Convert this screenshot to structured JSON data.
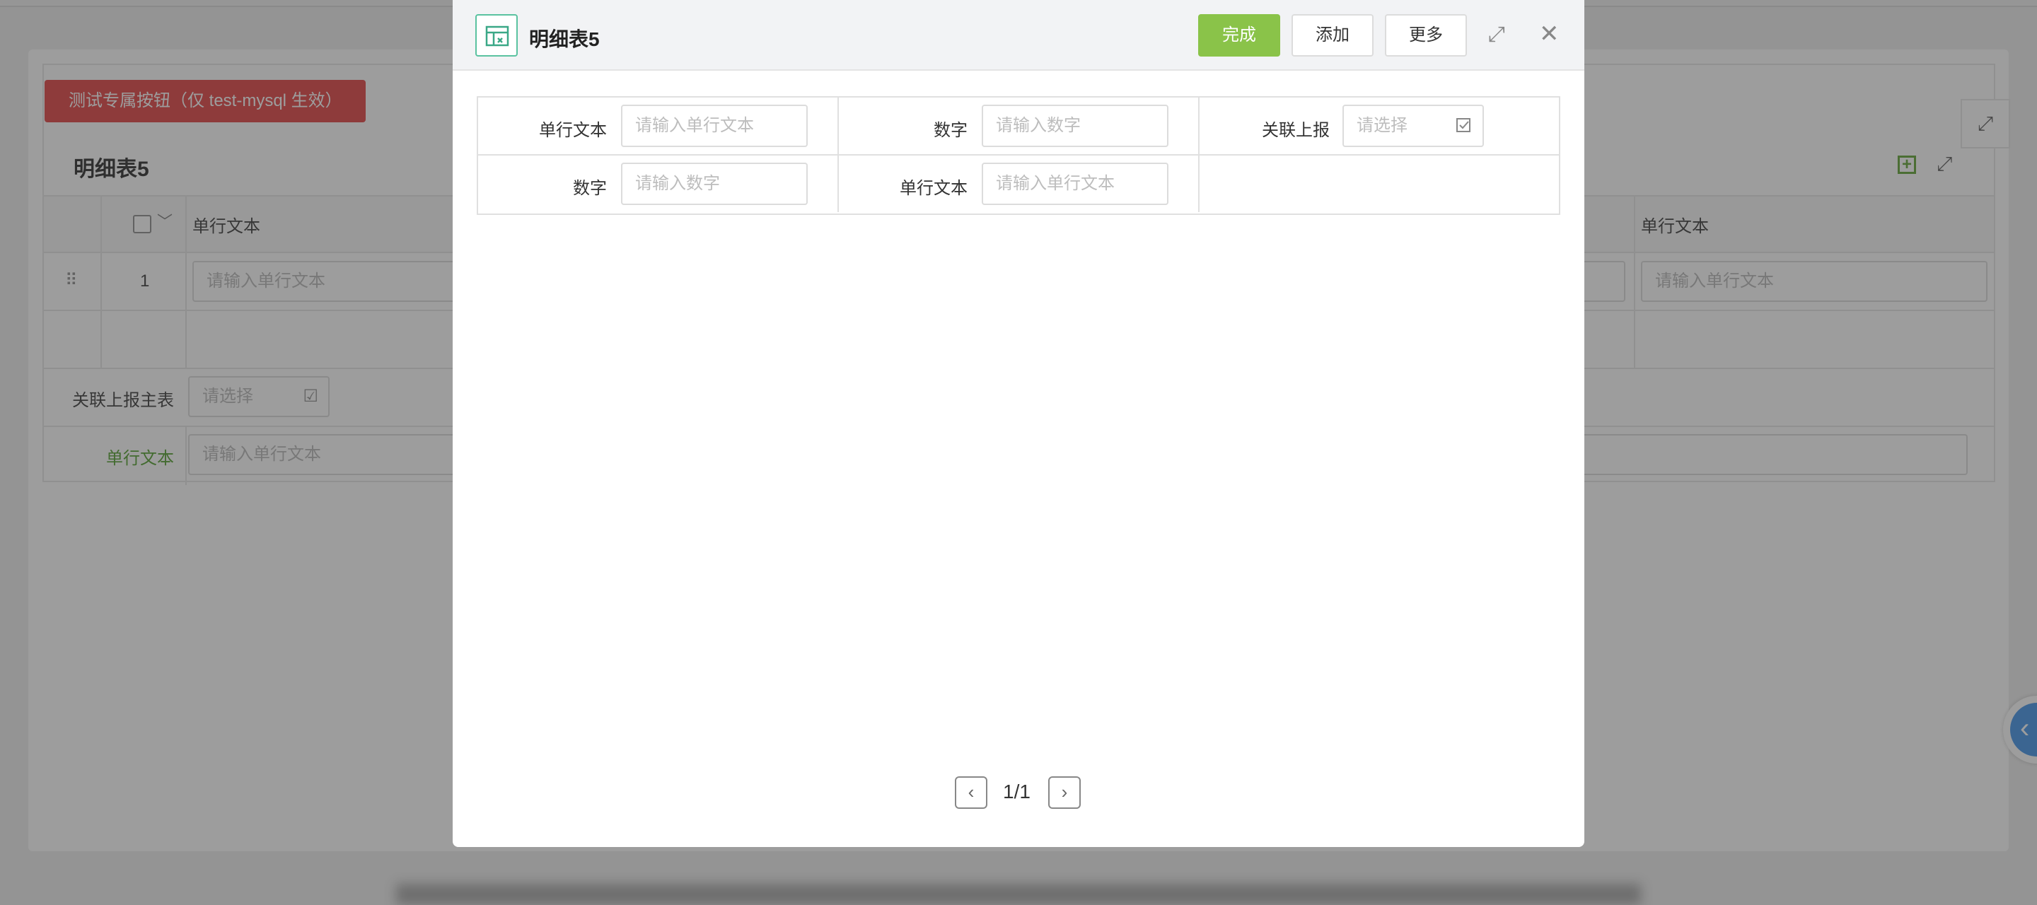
{
  "background": {
    "test_button_label": "测试专属按钮（仅 test-mysql 生效）",
    "table_title": "明细表5",
    "header_col1": "单行文本",
    "header_col_last": "单行文本",
    "row_index": "1",
    "row_input_placeholder": "请输入单行文本",
    "row_input_placeholder_right": "请输入单行文本",
    "link_label": "关联上报主表",
    "link_placeholder": "请选择",
    "text_label": "单行文本",
    "text_placeholder": "请输入单行文本"
  },
  "modal": {
    "title": "明细表5",
    "done_label": "完成",
    "add_label": "添加",
    "more_label": "更多",
    "fields": [
      {
        "label": "单行文本",
        "placeholder": "请输入单行文本"
      },
      {
        "label": "数字",
        "placeholder": "请输入数字"
      },
      {
        "label": "关联上报",
        "placeholder": "请选择"
      },
      {
        "label": "数字",
        "placeholder": "请输入数字"
      },
      {
        "label": "单行文本",
        "placeholder": "请输入单行文本"
      }
    ],
    "pagination": "1/1"
  },
  "colors": {
    "done": "#8ac349",
    "danger": "#e03a3a",
    "accent_green": "#4a9a24",
    "fab_blue": "#3b8ee6"
  }
}
